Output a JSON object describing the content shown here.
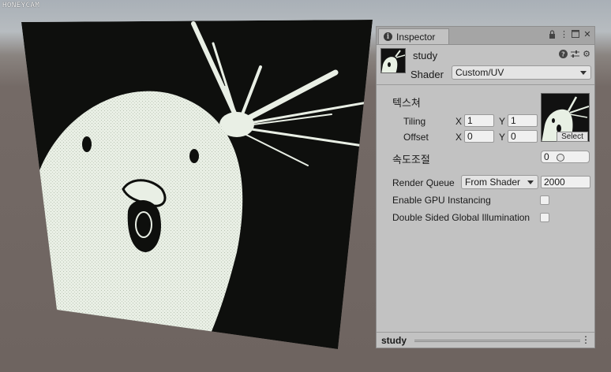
{
  "watermark": "HONEYCAM",
  "inspector": {
    "tab_title": "Inspector",
    "tab_icons": [
      "lock-icon",
      "menu-icon",
      "maximize-icon",
      "close-icon"
    ],
    "material_name": "study",
    "header_icons": [
      "help-icon",
      "preset-icon",
      "settings-icon"
    ],
    "shader_label": "Shader",
    "shader_value": "Custom/UV",
    "texture": {
      "label": "텍스쳐",
      "tiling_label": "Tiling",
      "offset_label": "Offset",
      "x_label": "X",
      "y_label": "Y",
      "tiling_x": "1",
      "tiling_y": "1",
      "offset_x": "0",
      "offset_y": "0",
      "select_label": "Select"
    },
    "speed": {
      "label": "속도조절",
      "value": "0"
    },
    "render_queue": {
      "label": "Render Queue",
      "mode": "From Shader",
      "value": "2000"
    },
    "gpu_instancing": {
      "label": "Enable GPU Instancing",
      "checked": false
    },
    "double_sided_gi": {
      "label": "Double Sided Global Illumination",
      "checked": false
    },
    "footer_title": "study"
  },
  "colors": {
    "panel_bg": "#c2c2c2",
    "texture_dark": "#111111",
    "texture_light": "#e8f0e4"
  }
}
